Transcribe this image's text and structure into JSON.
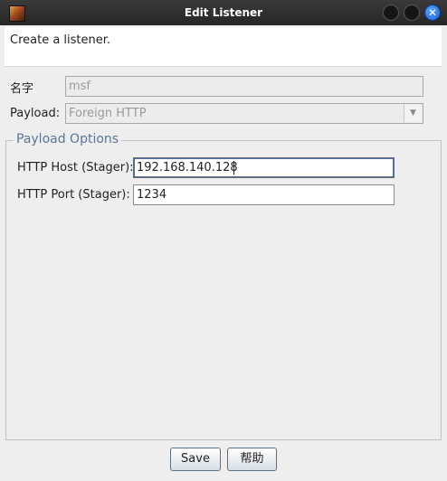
{
  "window": {
    "title": "Edit Listener",
    "close_glyph": "✕"
  },
  "description": "Create a listener.",
  "form": {
    "name_label": "名字",
    "name_value": "msf",
    "payload_label": "Payload:",
    "payload_value": "Foreign HTTP",
    "options_title": "Payload Options",
    "host_label": "HTTP Host (Stager):",
    "host_value": "192.168.140.128",
    "port_label": "HTTP Port (Stager):",
    "port_value": "1234"
  },
  "buttons": {
    "save": "Save",
    "help": "帮助"
  },
  "icons": {
    "app": "app-icon",
    "dropdown": "chevron-down-icon",
    "close": "close-icon"
  },
  "colors": {
    "accent": "#1b62d3",
    "group_title": "#5a7696"
  }
}
